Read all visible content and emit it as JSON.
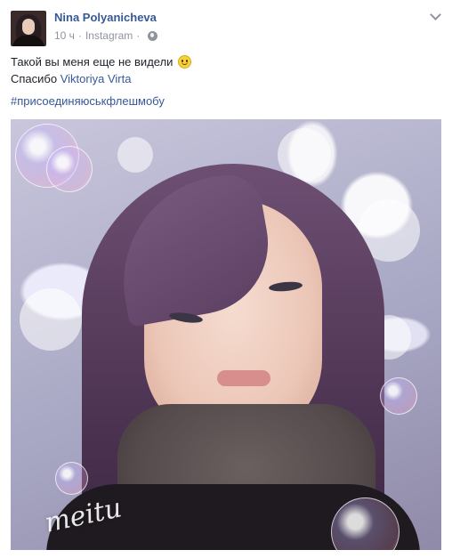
{
  "post": {
    "author": "Nina Polyanicheva",
    "time": "10 ч",
    "separator": "·",
    "source": "Instagram",
    "text_line1": "Такой вы меня еще не видели",
    "text_line2_prefix": "Спасибо",
    "mention": "Viktoriya Virta",
    "hashtag": "#присоединяюськфлешмобу",
    "photo_watermark": "meitu"
  },
  "icons": {
    "options": "chevron-down-icon",
    "privacy": "globe-icon",
    "emoji": "smiley-emoji-icon"
  },
  "colors": {
    "link": "#365899",
    "meta": "#90949c",
    "text": "#1d2129"
  }
}
